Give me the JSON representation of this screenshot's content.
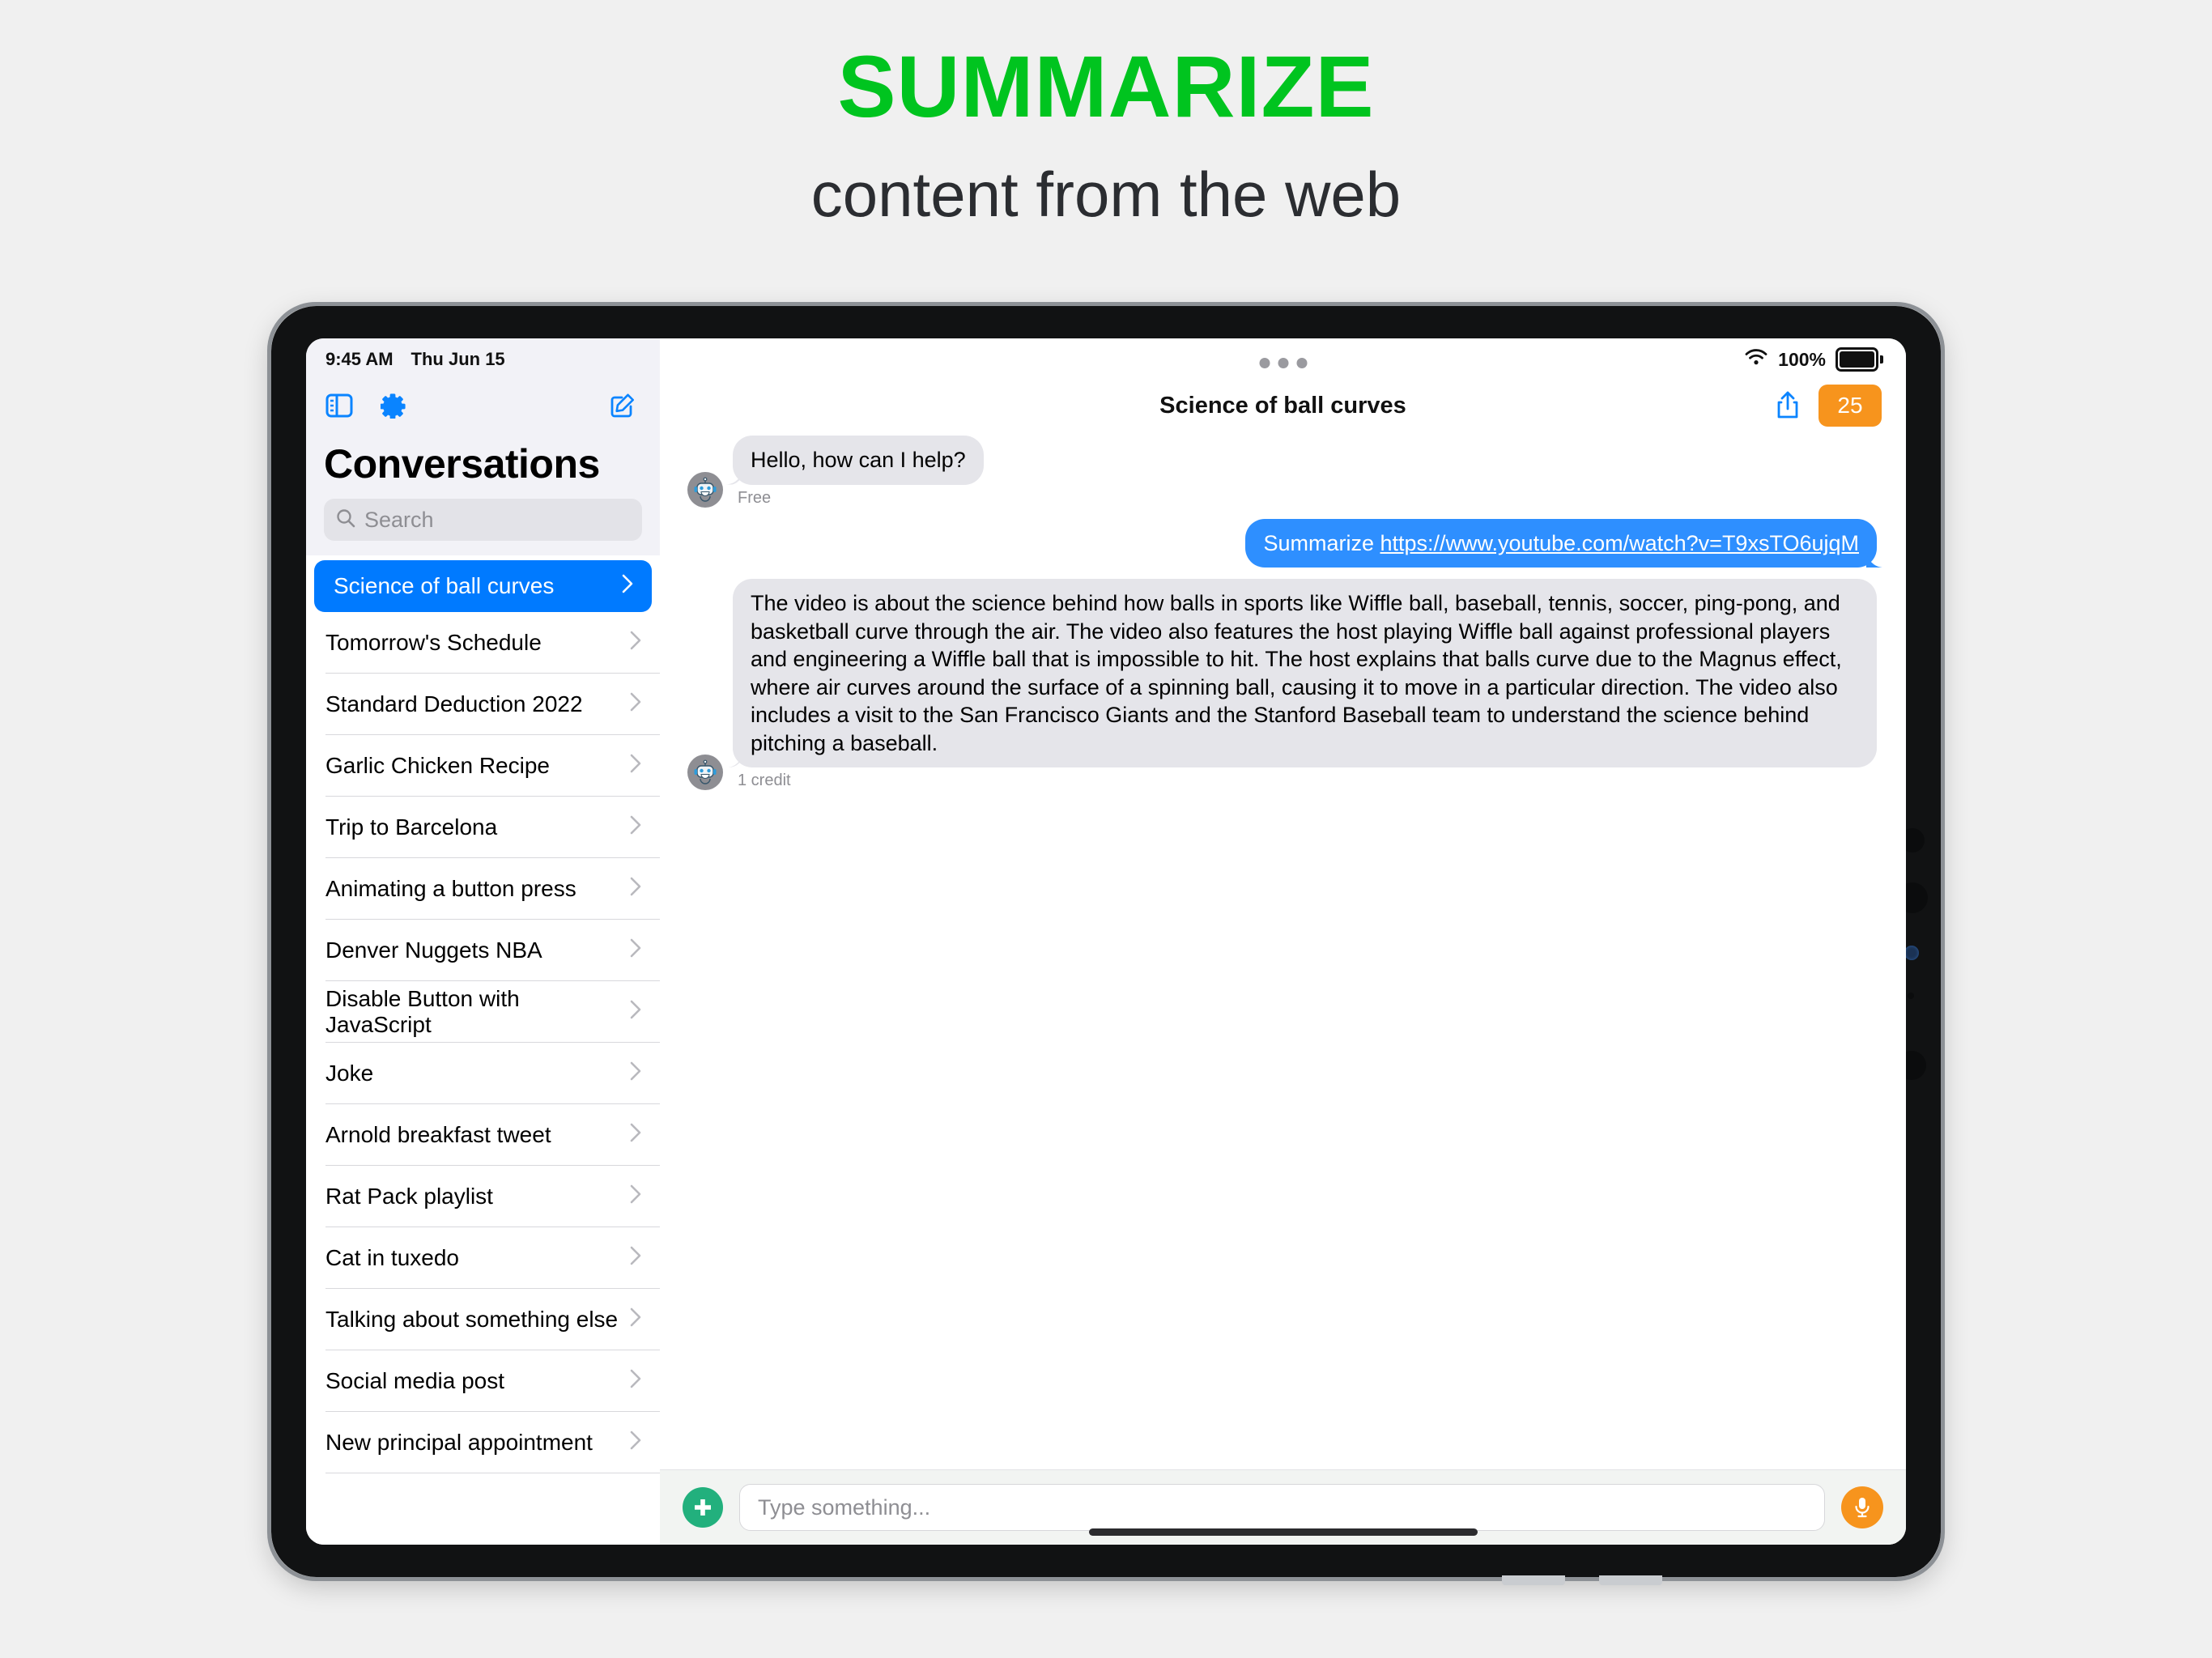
{
  "marketing": {
    "headline": "SUMMARIZE",
    "subhead": "content from the web",
    "headline_color": "#00c41f",
    "subhead_color": "#2b2d31",
    "background": "#f0f0f0"
  },
  "status_bar": {
    "time": "9:45 AM",
    "date": "Thu Jun 15",
    "wifi_icon": "wifi-icon",
    "battery_percent": "100%",
    "battery_icon": "battery-full-icon"
  },
  "sidebar": {
    "toolbar": {
      "sidebar_toggle_icon": "sidebar-toggle-icon",
      "settings_icon": "gear-icon",
      "compose_icon": "compose-icon",
      "accent": "#0a84ff"
    },
    "title": "Conversations",
    "search": {
      "placeholder": "Search",
      "icon": "search-icon"
    },
    "selected_index": 0,
    "selection_color": "#007aff",
    "items": [
      {
        "label": "Science of ball curves",
        "chevron": "chevron-right-icon",
        "selected": true
      },
      {
        "label": "Tomorrow's Schedule",
        "chevron": "chevron-right-icon",
        "selected": false
      },
      {
        "label": "Standard Deduction 2022",
        "chevron": "chevron-right-icon",
        "selected": false
      },
      {
        "label": "Garlic Chicken Recipe",
        "chevron": "chevron-right-icon",
        "selected": false
      },
      {
        "label": "Trip to Barcelona",
        "chevron": "chevron-right-icon",
        "selected": false
      },
      {
        "label": "Animating a button press",
        "chevron": "chevron-right-icon",
        "selected": false
      },
      {
        "label": "Denver Nuggets NBA",
        "chevron": "chevron-right-icon",
        "selected": false
      },
      {
        "label": "Disable Button with JavaScript",
        "chevron": "chevron-right-icon",
        "selected": false
      },
      {
        "label": "Joke",
        "chevron": "chevron-right-icon",
        "selected": false
      },
      {
        "label": "Arnold breakfast tweet",
        "chevron": "chevron-right-icon",
        "selected": false
      },
      {
        "label": "Rat Pack playlist",
        "chevron": "chevron-right-icon",
        "selected": false
      },
      {
        "label": "Cat in tuxedo",
        "chevron": "chevron-right-icon",
        "selected": false
      },
      {
        "label": "Talking about something else",
        "chevron": "chevron-right-icon",
        "selected": false
      },
      {
        "label": "Social media post",
        "chevron": "chevron-right-icon",
        "selected": false
      },
      {
        "label": "New principal appointment",
        "chevron": "chevron-right-icon",
        "selected": false
      }
    ]
  },
  "chat": {
    "multitask_handle": "multitasking-dots-icon",
    "title": "Science of ball curves",
    "share_icon": "share-icon",
    "credit_badge": "25",
    "credit_badge_color": "#f7941d",
    "messages": [
      {
        "role": "assistant",
        "avatar": "robot-avatar",
        "text": "Hello, how can I help?",
        "meta": "Free"
      },
      {
        "role": "user",
        "prefix": "Summarize ",
        "link": "https://www.youtube.com/watch?v=T9xsTO6ujqM",
        "bubble_color": "#2e8fff"
      },
      {
        "role": "assistant",
        "avatar": "robot-avatar",
        "text": "The video is about the science behind how balls in sports like Wiffle ball, baseball, tennis, soccer, ping-pong, and basketball curve through the air. The video also features the host playing Wiffle ball against professional players and engineering a Wiffle ball that is impossible to hit. The host explains that balls curve due to the Magnus effect, where air curves around the surface of a spinning ball, causing it to move in a particular direction. The video also includes a visit to the San Francisco Giants and the Stanford Baseball team to understand the science behind pitching a baseball.",
        "meta": "1 credit"
      }
    ]
  },
  "composer": {
    "add_icon": "plus-icon",
    "add_color": "#22b07d",
    "placeholder": "Type something...",
    "mic_icon": "microphone-icon",
    "mic_color": "#f7941d"
  }
}
